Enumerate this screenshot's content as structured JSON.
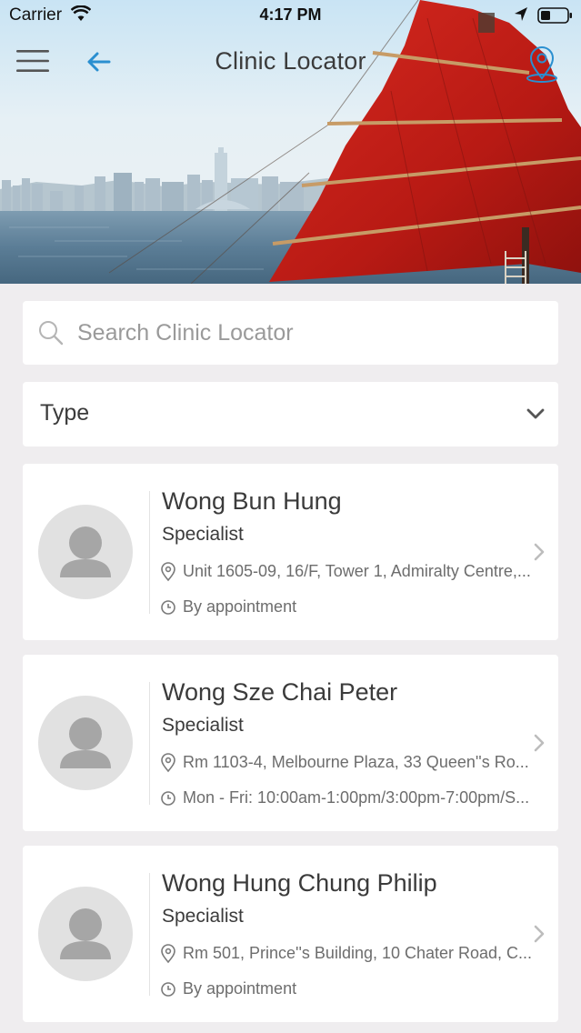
{
  "status_bar": {
    "carrier": "Carrier",
    "time": "4:17 PM"
  },
  "header": {
    "title": "Clinic Locator"
  },
  "search": {
    "placeholder": "Search Clinic Locator"
  },
  "filter": {
    "type_label": "Type"
  },
  "clinics": [
    {
      "name": "Wong Bun Hung",
      "type": "Specialist",
      "address": "Unit 1605-09, 16/F, Tower 1, Admiralty Centre,...",
      "hours": "By appointment"
    },
    {
      "name": "Wong Sze Chai Peter",
      "type": "Specialist",
      "address": "Rm 1103-4, Melbourne Plaza, 33 Queen''s Ro...",
      "hours": "Mon - Fri: 10:00am-1:00pm/3:00pm-7:00pm/S..."
    },
    {
      "name": "Wong Hung Chung Philip",
      "type": "Specialist",
      "address": "Rm 501, Prince''s Building, 10 Chater Road, C...",
      "hours": "By appointment"
    }
  ],
  "colors": {
    "accent_blue": "#2a8fd0",
    "sail_red": "#c8211b",
    "background": "#efedef"
  },
  "icons": {
    "menu": "menu-icon",
    "back": "back-arrow-icon",
    "map": "map-pin-icon",
    "search": "search-icon",
    "chevron_down": "chevron-down-icon",
    "location": "location-pin-icon",
    "clock": "clock-icon",
    "chevron_right": "chevron-right-icon"
  }
}
